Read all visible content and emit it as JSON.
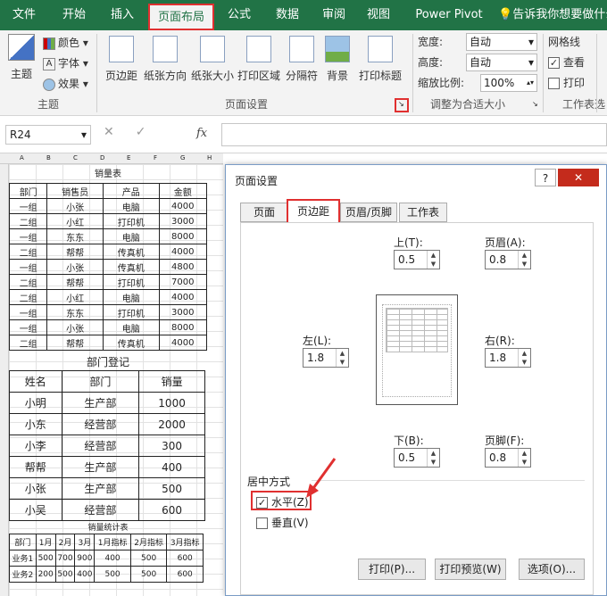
{
  "ribbon_tabs": [
    "文件",
    "开始",
    "插入",
    "页面布局",
    "公式",
    "数据",
    "审阅",
    "视图",
    "Power Pivot"
  ],
  "tell_me": "告诉我你想要做什么",
  "theme_group": {
    "label": "主题",
    "big": "主题",
    "colors": "颜色",
    "fonts": "字体",
    "effects": "效果"
  },
  "page_setup_group": {
    "label": "页面设置",
    "buttons": [
      "页边距",
      "纸张方向",
      "纸张大小",
      "打印区域",
      "分隔符",
      "背景",
      "打印标题"
    ]
  },
  "scale_group": {
    "label": "调整为合适大小",
    "width_label": "宽度:",
    "width_value": "自动",
    "height_label": "高度:",
    "height_value": "自动",
    "scale_label": "缩放比例:",
    "scale_value": "100%"
  },
  "sheet_options_group": {
    "label": "工作表选",
    "gridlines": "网格线",
    "view": "查看",
    "print": "打印",
    "view_checked": true
  },
  "name_box": "R24",
  "fx": "fx",
  "sheet": {
    "col_letters": [
      "A",
      "B",
      "C",
      "D",
      "E",
      "F",
      "G",
      "H"
    ],
    "t1_title": "销量表",
    "t1_headers": [
      "部门",
      "销售员",
      "产品",
      "金额"
    ],
    "t1_rows": [
      [
        "一组",
        "小张",
        "电脑",
        "4000"
      ],
      [
        "二组",
        "小红",
        "打印机",
        "3000"
      ],
      [
        "一组",
        "东东",
        "电脑",
        "8000"
      ],
      [
        "二组",
        "帮帮",
        "传真机",
        "4000"
      ],
      [
        "一组",
        "小张",
        "传真机",
        "4800"
      ],
      [
        "二组",
        "帮帮",
        "打印机",
        "7000"
      ],
      [
        "二组",
        "小红",
        "电脑",
        "4000"
      ],
      [
        "一组",
        "东东",
        "打印机",
        "3000"
      ],
      [
        "一组",
        "小张",
        "电脑",
        "8000"
      ],
      [
        "二组",
        "帮帮",
        "传真机",
        "4000"
      ]
    ],
    "t2_title": "部门登记",
    "t2_headers": [
      "姓名",
      "部门",
      "销量"
    ],
    "t2_rows": [
      [
        "小明",
        "生产部",
        "1000"
      ],
      [
        "小东",
        "经营部",
        "2000"
      ],
      [
        "小李",
        "经营部",
        "300"
      ],
      [
        "帮帮",
        "生产部",
        "400"
      ],
      [
        "小张",
        "生产部",
        "500"
      ],
      [
        "小吴",
        "经营部",
        "600"
      ]
    ],
    "t3_title": "销量统计表",
    "t3_headers": [
      "部门",
      "1月",
      "2月",
      "3月",
      "1月指标",
      "2月指标",
      "3月指标"
    ],
    "t3_rows": [
      [
        "业务1",
        "500",
        "700",
        "900",
        "400",
        "500",
        "600"
      ],
      [
        "业务2",
        "200",
        "500",
        "400",
        "500",
        "500",
        "600"
      ]
    ]
  },
  "dialog": {
    "title": "页面设置",
    "help": "?",
    "close": "✕",
    "tabs": [
      "页面",
      "页边距",
      "页眉/页脚",
      "工作表"
    ],
    "top_label": "上(T):",
    "top_value": "0.5",
    "header_label": "页眉(A):",
    "header_value": "0.8",
    "left_label": "左(L):",
    "left_value": "1.8",
    "right_label": "右(R):",
    "right_value": "1.8",
    "bottom_label": "下(B):",
    "bottom_value": "0.5",
    "footer_label": "页脚(F):",
    "footer_value": "0.8",
    "center_label": "居中方式",
    "horizontal": "水平(Z)",
    "horizontal_checked": true,
    "vertical": "垂直(V)",
    "vertical_checked": false,
    "print_btn": "打印(P)...",
    "preview_btn": "打印预览(W)",
    "options_btn": "选项(O)..."
  },
  "colors": {
    "excel_green": "#217346",
    "highlight_red": "#e03030"
  }
}
